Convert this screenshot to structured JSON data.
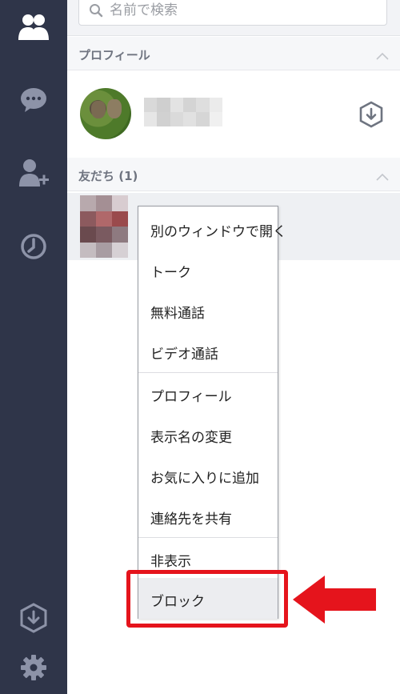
{
  "search": {
    "placeholder": "名前で検索"
  },
  "sections": {
    "profile": {
      "label": "プロフィール"
    },
    "friends": {
      "label": "友だち (1)"
    }
  },
  "context_menu": {
    "items": [
      {
        "label": "別のウィンドウで開く"
      },
      {
        "label": "トーク"
      },
      {
        "label": "無料通話"
      },
      {
        "label": "ビデオ通話"
      },
      {
        "label": "プロフィール"
      },
      {
        "label": "表示名の変更"
      },
      {
        "label": "お気に入りに追加"
      },
      {
        "label": "連絡先を共有"
      },
      {
        "label": "非表示"
      },
      {
        "label": "ブロック"
      }
    ],
    "highlighted": "ブロック"
  },
  "sidebar": {
    "icons": [
      "friends-icon",
      "chat-icon",
      "add-friend-icon",
      "timeline-icon",
      "download-icon",
      "settings-icon"
    ]
  },
  "colors": {
    "sidebar": "#2f3549",
    "sidebar_icon": "#8d93a8",
    "annotation": "#e5141c"
  }
}
